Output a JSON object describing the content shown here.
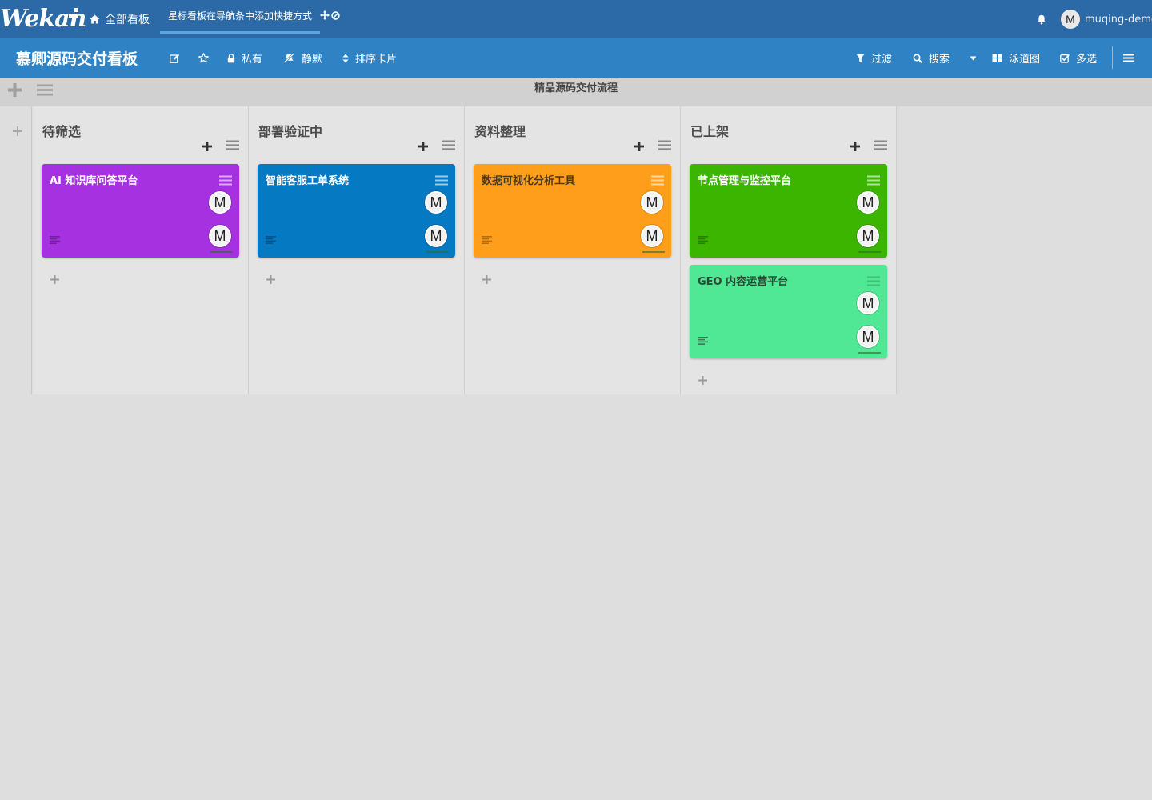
{
  "header": {
    "logo": "Wekan",
    "all_boards_label": "全部看板",
    "starred_hint": "星标看板在导航条中添加快捷方式",
    "user_initial": "M",
    "username": "muqing-demo"
  },
  "board": {
    "title": "慕卿源码交付看板",
    "private_label": "私有",
    "mute_label": "静默",
    "sort_label": "排序卡片",
    "filter_label": "过滤",
    "search_label": "搜索",
    "swimlane_view_label": "泳道图",
    "multiselect_label": "多选"
  },
  "swimlane": {
    "title": "精品源码交付流程"
  },
  "lists": [
    {
      "title": "待筛选",
      "cards": [
        {
          "title": "AI 知识库问答平台",
          "color": "#a531e0",
          "text_color": "#ffffff",
          "member": "M",
          "assignee": "M"
        }
      ]
    },
    {
      "title": "部署验证中",
      "cards": [
        {
          "title": "智能客服工单系统",
          "color": "#0679c3",
          "text_color": "#ffffff",
          "member": "M",
          "assignee": "M"
        }
      ]
    },
    {
      "title": "资料整理",
      "cards": [
        {
          "title": "数据可视化分析工具",
          "color": "#ff9e1a",
          "text_color": "#4d3a1a",
          "member": "M",
          "assignee": "M"
        }
      ]
    },
    {
      "title": "已上架",
      "cards": [
        {
          "title": "节点管理与监控平台",
          "color": "#3cb500",
          "text_color": "#ffffff",
          "member": "M",
          "assignee": "M"
        },
        {
          "title": "GEO 内容运营平台",
          "color": "#50e894",
          "text_color": "#2b4a36",
          "member": "M",
          "assignee": "M"
        }
      ]
    }
  ]
}
